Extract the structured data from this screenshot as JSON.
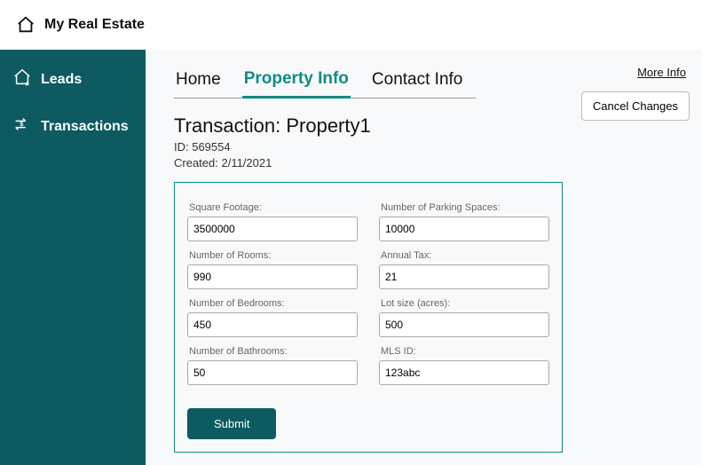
{
  "topbar": {
    "brand": "My Real Estate"
  },
  "sidebar": {
    "items": [
      {
        "label": "Leads"
      },
      {
        "label": "Transactions"
      }
    ]
  },
  "tabs": [
    {
      "label": "Home",
      "active": false
    },
    {
      "label": "Property Info",
      "active": true
    },
    {
      "label": "Contact Info",
      "active": false
    }
  ],
  "actions": {
    "more_info": "More Info",
    "cancel": "Cancel Changes",
    "submit": "Submit"
  },
  "transaction": {
    "title": "Transaction: Property1",
    "id_label": "ID: 569554",
    "created_label": "Created: 2/11/2021"
  },
  "fields_left": [
    {
      "label": "Square Footage:",
      "value": "3500000"
    },
    {
      "label": "Number of Rooms:",
      "value": "990"
    },
    {
      "label": "Number of Bedrooms:",
      "value": "450"
    },
    {
      "label": "Number of Bathrooms:",
      "value": "50"
    }
  ],
  "fields_right": [
    {
      "label": "Number of Parking Spaces:",
      "value": "10000"
    },
    {
      "label": "Annual Tax:",
      "value": "21"
    },
    {
      "label": "Lot size (acres):",
      "value": "500"
    },
    {
      "label": "MLS ID:",
      "value": "123abc"
    }
  ]
}
